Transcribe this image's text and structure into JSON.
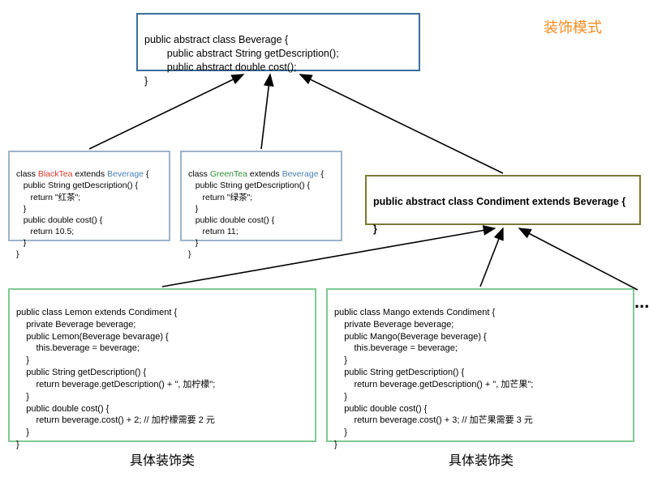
{
  "title": "装饰模式",
  "beverage": {
    "line1": "public abstract class Beverage {",
    "line2": "        public abstract String getDescription();",
    "line3": "        public abstract double cost();",
    "line4": "}"
  },
  "blacktea": {
    "open": "class ",
    "name": "BlackTea",
    "mid": " extends ",
    "ext": "Beverage",
    "close": " {",
    "l2": "   public String getDescription() {",
    "l3": "      return \"红茶\";",
    "l4": "   }",
    "l5": "   public double cost() {",
    "l6": "      return 10.5;",
    "l7": "   }",
    "l8": "}"
  },
  "greentea": {
    "open": "class ",
    "name": "GreenTea",
    "mid": " extends ",
    "ext": "Beverage",
    "close": " {",
    "l2": "   public String getDescription() {",
    "l3": "      return \"绿茶\";",
    "l4": "   }",
    "l5": "   public double cost() {",
    "l6": "      return 11;",
    "l7": "   }",
    "l8": "}"
  },
  "condiment": {
    "l1": "public abstract class Condiment extends Beverage {",
    "l2": "",
    "l3": "}"
  },
  "lemon": {
    "l1": "public class Lemon extends Condiment {",
    "l2": "    private Beverage beverage;",
    "l3": "    public Lemon(Beverage bevarage) {",
    "l4": "        this.beverage = beverage;",
    "l5": "    }",
    "l6": "    public String getDescription() {",
    "l7": "        return beverage.getDescription() + \", 加柠檬\";",
    "l8": "    }",
    "l9": "    public double cost() {",
    "l10": "        return beverage.cost() + 2; // 加柠檬需要 2 元",
    "l11": "    }",
    "l12": "}"
  },
  "mango": {
    "l1": "public class Mango extends Condiment {",
    "l2": "    private Beverage beverage;",
    "l3": "    public Mango(Beverage beverage) {",
    "l4": "        this.beverage = beverage;",
    "l5": "    }",
    "l6": "    public String getDescription() {",
    "l7": "        return beverage.getDescription() + \", 加芒果\";",
    "l8": "    }",
    "l9": "    public double cost() {",
    "l10": "        return beverage.cost() + 3; // 加芒果需要 3 元",
    "l11": "    }",
    "l12": "}"
  },
  "caption_left": "具体装饰类",
  "caption_right": "具体装饰类",
  "ellipsis": "..."
}
